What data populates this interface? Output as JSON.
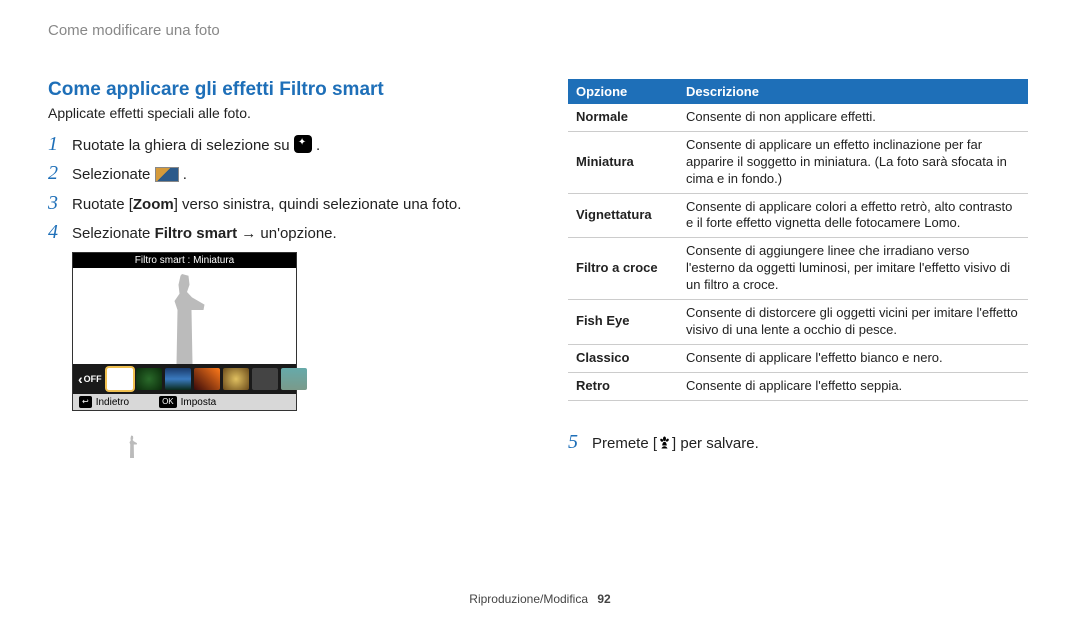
{
  "header": {
    "breadcrumb": "Come modificare una foto"
  },
  "left": {
    "title": "Come applicare gli effetti Filtro smart",
    "subtitle": "Applicate effetti speciali alle foto.",
    "steps": {
      "s1_a": "Ruotate la ghiera di selezione su ",
      "s1_b": ".",
      "s2_a": "Selezionate ",
      "s2_b": ".",
      "s3_a": "Ruotate [",
      "s3_zoom": "Zoom",
      "s3_b": "] verso sinistra, quindi selezionate una foto.",
      "s4_a": "Selezionate ",
      "s4_bold": "Filtro smart",
      "s4_b": " → un'opzione."
    },
    "preview": {
      "title": "Filtro smart : Miniatura",
      "off": "OFF",
      "back_key": "↩",
      "back_label": "Indietro",
      "set_key": "OK",
      "set_label": "Imposta"
    }
  },
  "right": {
    "table": {
      "head_opt": "Opzione",
      "head_desc": "Descrizione",
      "rows": [
        {
          "opt": "Normale",
          "desc": "Consente di non applicare effetti."
        },
        {
          "opt": "Miniatura",
          "desc": "Consente di applicare un effetto inclinazione per far apparire il soggetto in miniatura. (La foto sarà sfocata in cima e in fondo.)"
        },
        {
          "opt": "Vignettatura",
          "desc": "Consente di applicare colori a effetto retrò, alto contrasto e il forte effetto vignetta delle fotocamere Lomo."
        },
        {
          "opt": "Filtro a croce",
          "desc": "Consente di aggiungere linee che irradiano verso l'esterno da oggetti luminosi, per imitare l'effetto visivo di un filtro a croce."
        },
        {
          "opt": "Fish Eye",
          "desc": "Consente di distorcere gli oggetti vicini per imitare l'effetto visivo di una lente a occhio di pesce."
        },
        {
          "opt": "Classico",
          "desc": "Consente di applicare l'effetto bianco e nero."
        },
        {
          "opt": "Retro",
          "desc": "Consente di applicare l'effetto seppia."
        }
      ]
    },
    "step5_a": "Premete [",
    "step5_b": "] per salvare.",
    "step5_num": "5",
    "nums": {
      "n1": "1",
      "n2": "2",
      "n3": "3",
      "n4": "4"
    }
  },
  "footer": {
    "section": "Riproduzione/Modifica",
    "page": "92"
  }
}
